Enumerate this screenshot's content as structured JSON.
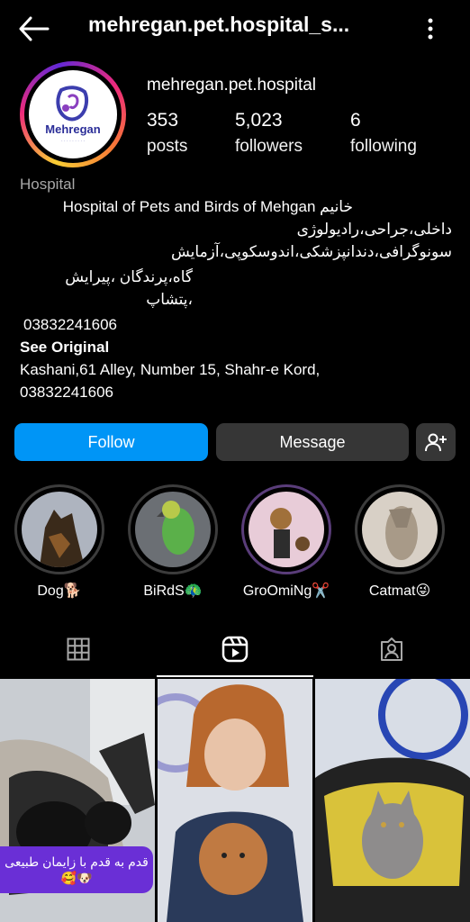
{
  "header": {
    "title": "mehregan.pet.hospital_s...",
    "back_icon": "arrow-left-icon",
    "more_icon": "more-vertical-icon"
  },
  "profile": {
    "logo_text": "Mehregan",
    "username": "mehregan.pet.hospital",
    "stats": [
      {
        "value": "353",
        "label": "posts"
      },
      {
        "value": "5,023",
        "label": "followers"
      },
      {
        "value": "6",
        "label": "following"
      }
    ]
  },
  "bio": {
    "category": "Hospital",
    "line1": "Hospital of Pets and Birds of Mehgan خانیم",
    "line2": "داخلی،جراحی،رادیولوژی سونوگرافی،دندانپزشکی،اندوسکوپی،آزمایش",
    "line3": "گاه،پرندگان ،پیرایش ،پتشاپ",
    "phone": "03832241606",
    "see_original": "See Original",
    "address": "Kashani,61 Alley, Number 15, Shahr-e Kord,",
    "address_phone": "03832241606"
  },
  "actions": {
    "follow": "Follow",
    "message": "Message",
    "add_user_icon": "add-user-icon"
  },
  "highlights": [
    {
      "label": "Dog🐕"
    },
    {
      "label": "BiRdS🦚"
    },
    {
      "label": "GroOmiNg✂️"
    },
    {
      "label": "Catmat😜"
    }
  ],
  "tabs": [
    {
      "icon": "grid-icon"
    },
    {
      "icon": "reels-icon"
    },
    {
      "icon": "tagged-icon"
    }
  ],
  "posts": [
    {
      "caption": "قدم به قدم با زایمان طبیعی 🥰🐶"
    },
    {
      "caption": ""
    },
    {
      "caption": ""
    }
  ],
  "colors": {
    "accent": "#0095f6",
    "button_secondary": "#363636",
    "caption_bg": "#6a2fd6"
  }
}
